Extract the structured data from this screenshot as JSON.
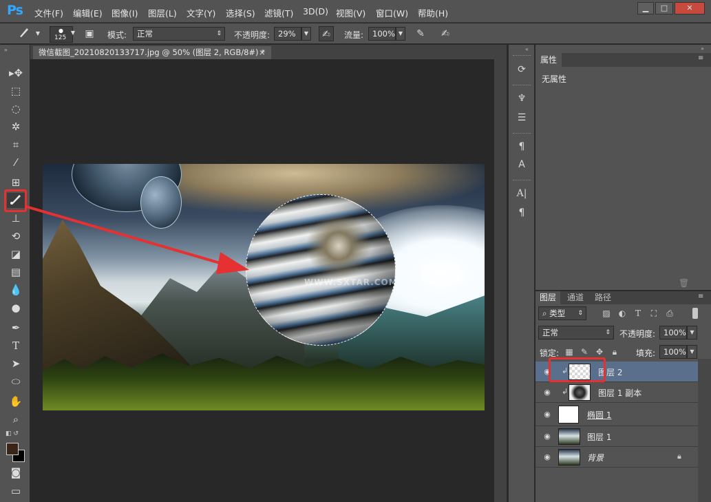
{
  "app": {
    "logo": "Ps",
    "menu": [
      "文件(F)",
      "编辑(E)",
      "图像(I)",
      "图层(L)",
      "文字(Y)",
      "选择(S)",
      "滤镜(T)",
      "3D(D)",
      "视图(V)",
      "窗口(W)",
      "帮助(H)"
    ],
    "window_controls": {
      "minimize": "▁",
      "maximize": "□",
      "close": "✕"
    }
  },
  "options": {
    "brush_size": "125",
    "mode_label": "模式:",
    "mode_value": "正常",
    "opacity_label": "不透明度:",
    "opacity_value": "29%",
    "flow_label": "流量:",
    "flow_value": "100%"
  },
  "document": {
    "tab_title": "微信截图_20210820133717.jpg @ 50% (图层 2, RGB/8#) *",
    "close": "×",
    "watermark": "WWW.SXTAR.COM"
  },
  "properties": {
    "tab": "属性",
    "body": "无属性"
  },
  "layers": {
    "tabs": [
      "图层",
      "通道",
      "路径"
    ],
    "filter_kind": "类型",
    "blend_mode": "正常",
    "opacity_label": "不透明度:",
    "opacity_value": "100%",
    "lock_label": "锁定:",
    "fill_label": "填充:",
    "fill_value": "100%",
    "items": [
      {
        "name": "图层 2"
      },
      {
        "name": "图层 1 副本"
      },
      {
        "name": "椭圆 1"
      },
      {
        "name": "图层 1"
      },
      {
        "name": "背景"
      }
    ]
  },
  "colors": {
    "accent_red": "#e53131",
    "ps_blue": "#31a8ff",
    "selected_layer": "#5a6f8c",
    "foreground": "#3b2516",
    "background": "#000000"
  },
  "icons": [
    "brush-icon",
    "move-icon",
    "marquee-icon",
    "lasso-icon",
    "magic-wand-icon",
    "crop-icon",
    "eyedropper-icon",
    "healing-icon",
    "stamp-icon",
    "history-brush-icon",
    "eraser-icon",
    "gradient-icon",
    "blur-icon",
    "dodge-icon",
    "pen-icon",
    "type-icon",
    "path-select-icon",
    "ellipse-icon",
    "hand-icon",
    "zoom-icon",
    "eye-icon",
    "lock-icon",
    "trash-icon"
  ]
}
